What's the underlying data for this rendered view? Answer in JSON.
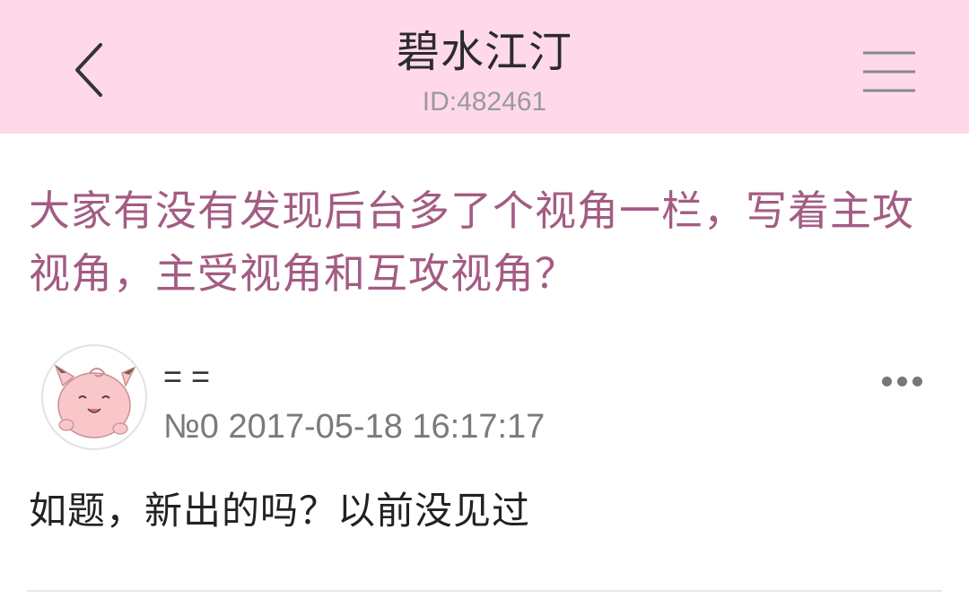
{
  "header": {
    "back_icon": "chevron-left-icon",
    "title": "碧水江汀",
    "subtitle": "ID:482461",
    "menu_icon": "hamburger-menu-icon",
    "background_color": "#ffd9ea"
  },
  "post": {
    "title": "大家有没有发现后台多了个视角一栏，写着主攻视角，主受视角和互攻视角？",
    "title_color": "#a35c83",
    "author": {
      "avatar_icon": "pink-creature-avatar",
      "name": "= =",
      "floor_and_time": "№0 2017-05-18 16:17:17"
    },
    "more_icon": "more-dots-icon",
    "body": "如题，新出的吗？以前没见过"
  }
}
